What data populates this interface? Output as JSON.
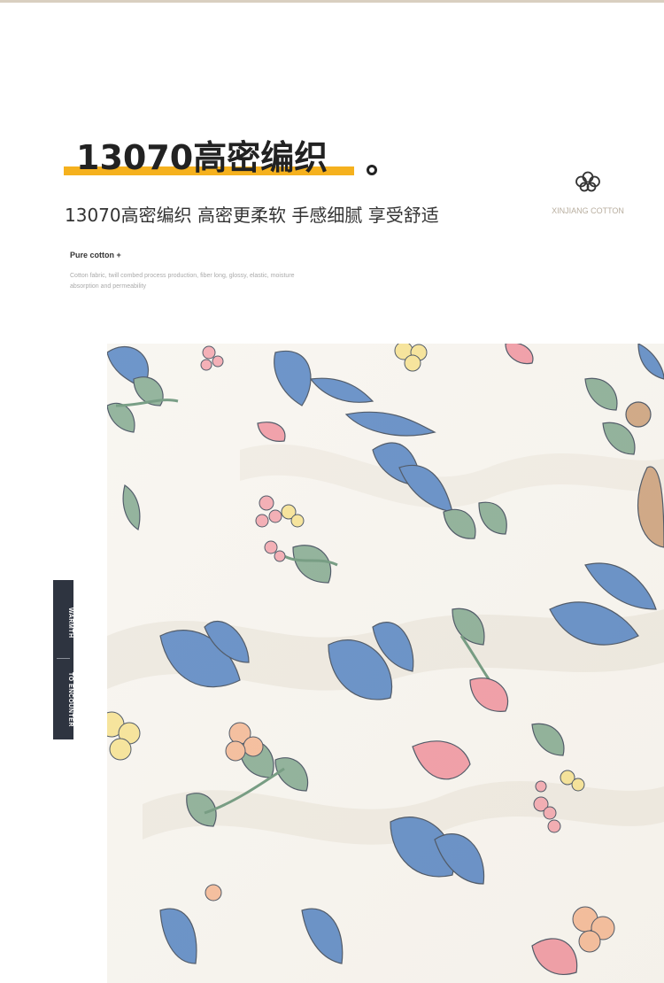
{
  "header": {
    "title": "13070高密编织",
    "subtitle": "13070高密编织 高密更柔软 手感细腻 享受舒适",
    "badge_label": "XINJIANG COTTON",
    "badge_icon": "cotton-flower-icon"
  },
  "info": {
    "label": "Pure cotton +",
    "description": "Cotton fabric, twill combed process production, fiber long, glossy, elastic, moisture absorption and permeability"
  },
  "side_tag": {
    "line1": "WARMTH",
    "line2": "TO ENCOUNTER"
  },
  "colors": {
    "accent": "#f5b11e",
    "tag_bg": "#2e3440",
    "fabric_bg": "#f6f3ec",
    "leaf_blue": "#4f7fbf",
    "leaf_green": "#7ea58a",
    "petal_pink": "#f2a0a8",
    "petal_yellow": "#f5e08a"
  }
}
